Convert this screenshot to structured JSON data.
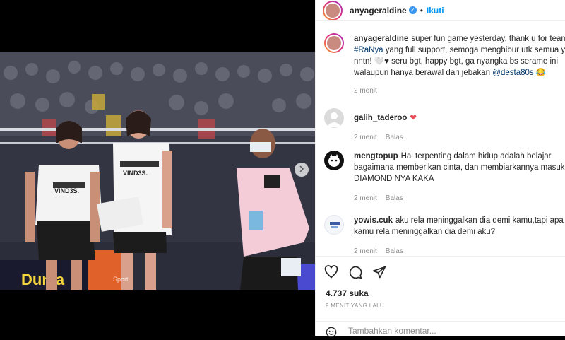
{
  "post": {
    "username": "anyageraldine",
    "verified_mark": "✓",
    "separator": "•",
    "follow_label": "Ikuti"
  },
  "caption": {
    "username": "anyageraldine",
    "line1": "super fun game yesterday, thank u for team",
    "hashtag": "#RaNya",
    "line2": "yang full support, semoga menghibur utk semua yg",
    "line3": "nntn! 🤍♥ seru bgt, happy bgt, ga nyangka bs serame ini",
    "line4a": "walaupun hanya berawal dari jebakan",
    "mention": "@desta80s",
    "emoji": "😂",
    "time": "2 menit"
  },
  "comments": [
    {
      "username": "galih_taderoo",
      "text": "❤",
      "time": "2 menit",
      "reply": "Balas"
    },
    {
      "username": "mengtopup",
      "line1": "Hal terpenting dalam hidup adalah belajar",
      "line2": "bagaimana memberikan cinta, dan membiarkannya masuk.",
      "line3": "DIAMOND NYA KAKA",
      "time": "2 menit",
      "reply": "Balas"
    },
    {
      "username": "yowis.cuk",
      "line1": "aku rela meninggalkan dia demi kamu,tapi apa",
      "line2": "kamu rela meninggalkan dia demi aku?",
      "time": "2 menit",
      "reply": "Balas"
    }
  ],
  "likes": "4.737 suka",
  "time_ago": "9 MENIT YANG LALU",
  "add_comment_placeholder": "Tambahkan komentar...",
  "photo": {
    "shirt_text": "VIND3S.",
    "banner_text": "Dunia",
    "watermark": "Sport"
  },
  "icons": [
    "heart-icon",
    "comment-icon",
    "share-icon",
    "emoji-icon",
    "chevron-right-icon"
  ]
}
